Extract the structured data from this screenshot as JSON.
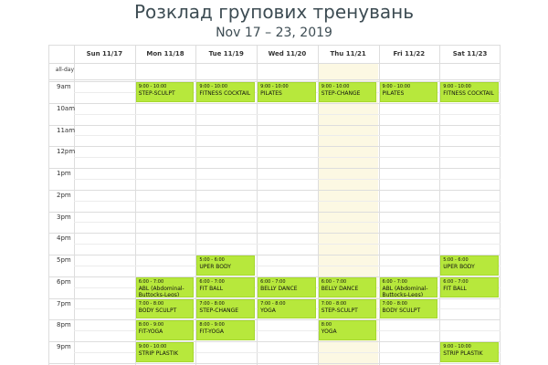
{
  "header": {
    "title": "Розклад групових тренувань",
    "date_range": "Nov 17 – 23, 2019"
  },
  "calendar": {
    "allday_label": "all-day",
    "today_column": "Thu 11/21",
    "days": [
      "Sun 11/17",
      "Mon 11/18",
      "Tue 11/19",
      "Wed 11/20",
      "Thu 11/21",
      "Fri 11/22",
      "Sat 11/23"
    ],
    "time_labels": [
      "9am",
      "10am",
      "11am",
      "12pm",
      "1pm",
      "2pm",
      "3pm",
      "4pm",
      "5pm",
      "6pm",
      "7pm",
      "8pm",
      "9pm"
    ],
    "colors": {
      "event_bg": "#b7e83c",
      "today_bg": "#fcf8e3",
      "grid": "#dddddd"
    },
    "events": [
      {
        "day": 1,
        "start": 9,
        "end": 10,
        "time": "9:00 - 10:00",
        "title": "STEP-SCULPT"
      },
      {
        "day": 2,
        "start": 9,
        "end": 10,
        "time": "9:00 - 10:00",
        "title": "FITNESS COCKTAIL"
      },
      {
        "day": 3,
        "start": 9,
        "end": 10,
        "time": "9:00 - 10:00",
        "title": "PILATES"
      },
      {
        "day": 4,
        "start": 9,
        "end": 10,
        "time": "9:00 - 10:00",
        "title": "STEP-CHANGE"
      },
      {
        "day": 5,
        "start": 9,
        "end": 10,
        "time": "9:00 - 10:00",
        "title": "PILATES"
      },
      {
        "day": 6,
        "start": 9,
        "end": 10,
        "time": "9:00 - 10:00",
        "title": "FITNESS COCKTAIL"
      },
      {
        "day": 2,
        "start": 17,
        "end": 18,
        "time": "5:00 - 6:00",
        "title": "UPER BODY"
      },
      {
        "day": 6,
        "start": 17,
        "end": 18,
        "time": "5:00 - 6:00",
        "title": "UPER BODY"
      },
      {
        "day": 1,
        "start": 18,
        "end": 19,
        "time": "6:00 - 7:00",
        "title": "ABL (Abdominal-Buttocks-Legs)"
      },
      {
        "day": 2,
        "start": 18,
        "end": 19,
        "time": "6:00 - 7:00",
        "title": "FIT BALL"
      },
      {
        "day": 3,
        "start": 18,
        "end": 19,
        "time": "6:00 - 7:00",
        "title": "BELLY DANCE"
      },
      {
        "day": 4,
        "start": 18,
        "end": 19,
        "time": "6:00 - 7:00",
        "title": "BELLY DANCE"
      },
      {
        "day": 5,
        "start": 18,
        "end": 19,
        "time": "6:00 - 7:00",
        "title": "ABL (Abdominal-Buttocks-Legs)"
      },
      {
        "day": 6,
        "start": 18,
        "end": 19,
        "time": "6:00 - 7:00",
        "title": "FIT BALL"
      },
      {
        "day": 1,
        "start": 19,
        "end": 20,
        "time": "7:00 - 8:00",
        "title": "BODY SCULPT"
      },
      {
        "day": 2,
        "start": 19,
        "end": 20,
        "time": "7:00 - 8:00",
        "title": "STEP-CHANGE"
      },
      {
        "day": 3,
        "start": 19,
        "end": 20,
        "time": "7:00 - 8:00",
        "title": "YOGA"
      },
      {
        "day": 4,
        "start": 19,
        "end": 20,
        "time": "7:00 - 8:00",
        "title": "STEP-SCULPT"
      },
      {
        "day": 5,
        "start": 19,
        "end": 20,
        "time": "7:00 - 8:00",
        "title": "BODY SCULPT"
      },
      {
        "day": 1,
        "start": 20,
        "end": 21,
        "time": "8:00 - 9:00",
        "title": "FIT-YOGA"
      },
      {
        "day": 2,
        "start": 20,
        "end": 21,
        "time": "8:00 - 9:00",
        "title": "FIT-YOGA"
      },
      {
        "day": 4,
        "start": 20,
        "end": 21,
        "time": "8:00",
        "title": "YOGA"
      },
      {
        "day": 1,
        "start": 21,
        "end": 22,
        "time": "9:00 - 10:00",
        "title": "STRIP PLASTIK"
      },
      {
        "day": 6,
        "start": 21,
        "end": 22,
        "time": "9:00 - 10:00",
        "title": "STRIP PLASTIK"
      }
    ]
  }
}
